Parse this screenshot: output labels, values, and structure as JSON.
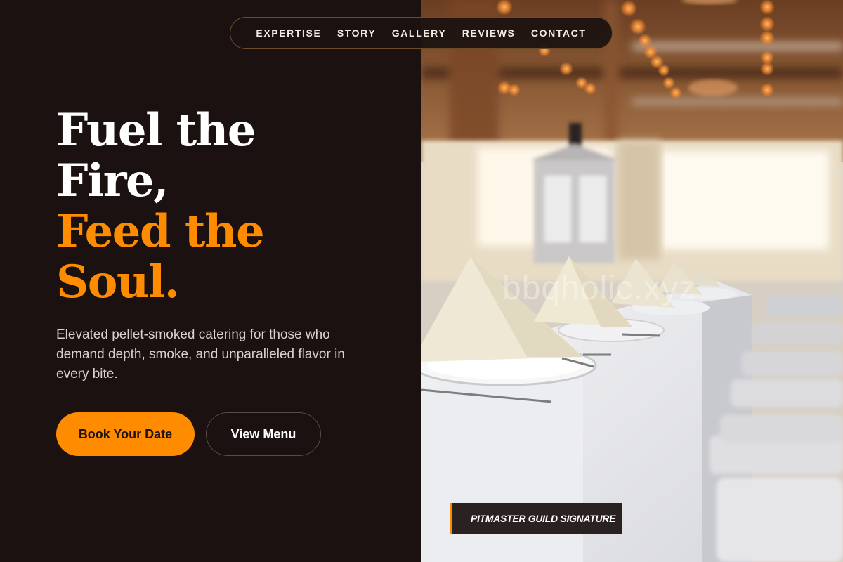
{
  "nav": {
    "items": [
      "EXPERTISE",
      "STORY",
      "GALLERY",
      "REVIEWS",
      "CONTACT"
    ]
  },
  "hero": {
    "headline": {
      "line1": "Fuel the",
      "line2": "Fire,",
      "line3": "Feed the",
      "line4": "Soul."
    },
    "lead": "Elevated pellet-smoked catering for those who demand depth, smoke, and unparalleled flavor in every bite.",
    "primary_cta": "Book Your Date",
    "secondary_cta": "View Menu"
  },
  "image": {
    "watermark": "bbqholic.xyz",
    "badge": "PITMASTER GUILD SIGNATURE"
  },
  "colors": {
    "background": "#1a1110",
    "accent": "#ff8c00",
    "text_light": "#d9d1cb"
  }
}
